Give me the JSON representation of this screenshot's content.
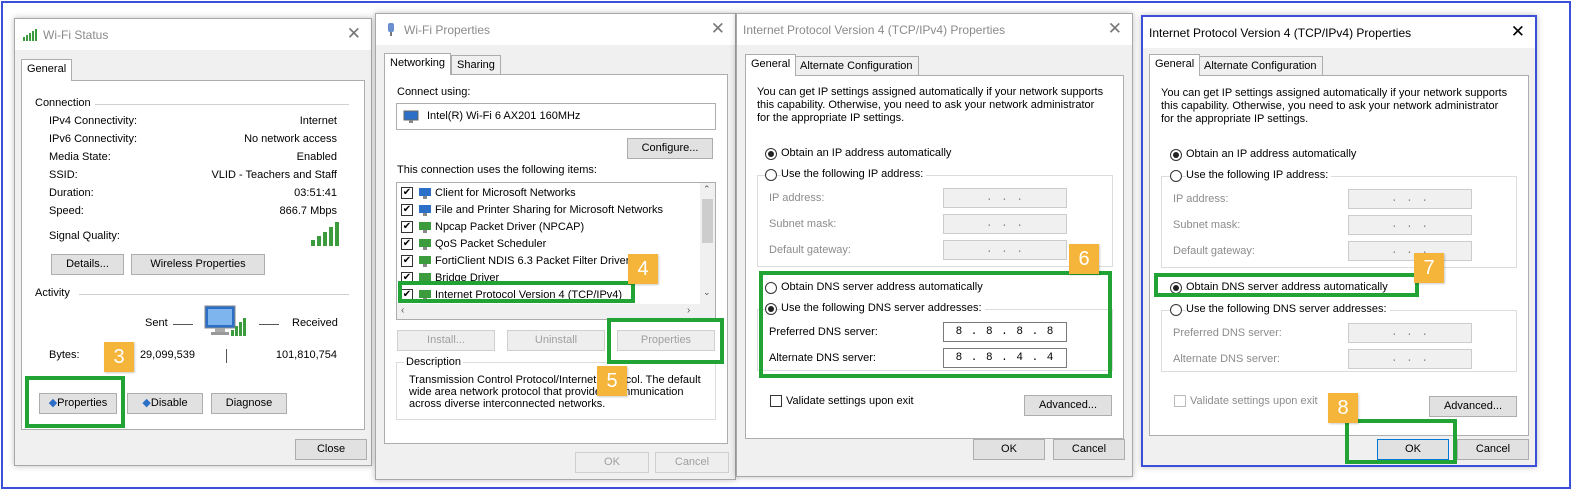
{
  "colors": {
    "highlight": "#21a336",
    "badge": "#f5b43a",
    "active_border": "#3b4fd8"
  },
  "badges": [
    "3",
    "4",
    "5",
    "6",
    "7",
    "8"
  ],
  "wifi_status": {
    "title": "Wi-Fi Status",
    "icon": "wifi-signal-icon",
    "tab": "General",
    "connection_heading": "Connection",
    "rows": [
      {
        "label": "IPv4 Connectivity:",
        "value": "Internet"
      },
      {
        "label": "IPv6 Connectivity:",
        "value": "No network access"
      },
      {
        "label": "Media State:",
        "value": "Enabled"
      },
      {
        "label": "SSID:",
        "value": "VLID - Teachers and Staff"
      },
      {
        "label": "Duration:",
        "value": "03:51:41"
      },
      {
        "label": "Speed:",
        "value": "866.7 Mbps"
      }
    ],
    "signal_label": "Signal Quality:",
    "details_button": "Details...",
    "wireless_button": "Wireless Properties",
    "activity_heading": "Activity",
    "sent_label": "Sent",
    "received_label": "Received",
    "bytes_label": "Bytes:",
    "bytes_sent": "29,099,539",
    "bytes_received": "101,810,754",
    "properties_button": "Properties",
    "disable_button": "Disable",
    "diagnose_button": "Diagnose",
    "close_button": "Close"
  },
  "wifi_properties": {
    "title": "Wi-Fi Properties",
    "icon": "network-adapter-icon",
    "tabs": [
      "Networking",
      "Sharing"
    ],
    "connect_using_label": "Connect using:",
    "adapter": "Intel(R) Wi-Fi 6 AX201 160MHz",
    "configure_button": "Configure...",
    "items_label": "This connection uses the following items:",
    "items": [
      {
        "label": "Client for Microsoft Networks",
        "checked": true
      },
      {
        "label": "File and Printer Sharing for Microsoft Networks",
        "checked": true
      },
      {
        "label": "Npcap Packet Driver (NPCAP)",
        "checked": true
      },
      {
        "label": "QoS Packet Scheduler",
        "checked": true
      },
      {
        "label": "FortiClient NDIS 6.3 Packet Filter Driver",
        "checked": true
      },
      {
        "label": "Bridge Driver",
        "checked": true
      },
      {
        "label": "Internet Protocol Version 4 (TCP/IPv4)",
        "checked": true
      }
    ],
    "install_button": "Install...",
    "uninstall_button": "Uninstall",
    "properties_button": "Properties",
    "description_heading": "Description",
    "description": "Transmission Control Protocol/Internet Protocol. The default wide area network protocol that provides communication across diverse interconnected networks.",
    "ok_button": "OK",
    "cancel_button": "Cancel"
  },
  "ipv4_manual": {
    "title": "Internet Protocol Version 4 (TCP/IPv4) Properties",
    "tabs": [
      "General",
      "Alternate Configuration"
    ],
    "intro": "You can get IP settings assigned automatically if your network supports this capability. Otherwise, you need to ask your network administrator for the appropriate IP settings.",
    "obtain_ip": "Obtain an IP address automatically",
    "use_ip": "Use the following IP address:",
    "ip_address_label": "IP address:",
    "subnet_label": "Subnet mask:",
    "gateway_label": "Default gateway:",
    "empty_ip": ".     .     .",
    "obtain_dns": "Obtain DNS server address automatically",
    "use_dns": "Use the following DNS server addresses:",
    "preferred_label": "Preferred DNS server:",
    "preferred_value": "8 . 8 . 8 . 8",
    "alternate_label": "Alternate DNS server:",
    "alternate_value": "8 . 8 . 4 . 4",
    "validate": "Validate settings upon exit",
    "advanced_button": "Advanced...",
    "ok_button": "OK",
    "cancel_button": "Cancel"
  },
  "ipv4_auto": {
    "title": "Internet Protocol Version 4 (TCP/IPv4) Properties",
    "tabs": [
      "General",
      "Alternate Configuration"
    ],
    "intro": "You can get IP settings assigned automatically if your network supports this capability. Otherwise, you need to ask your network administrator for the appropriate IP settings.",
    "obtain_ip": "Obtain an IP address automatically",
    "use_ip": "Use the following IP address:",
    "ip_address_label": "IP address:",
    "subnet_label": "Subnet mask:",
    "gateway_label": "Default gateway:",
    "empty_ip": ".     .     .",
    "obtain_dns": "Obtain DNS server address automatically",
    "use_dns": "Use the following DNS server addresses:",
    "preferred_label": "Preferred DNS server:",
    "alternate_label": "Alternate DNS server:",
    "validate": "Validate settings upon exit",
    "advanced_button": "Advanced...",
    "ok_button": "OK",
    "cancel_button": "Cancel"
  }
}
